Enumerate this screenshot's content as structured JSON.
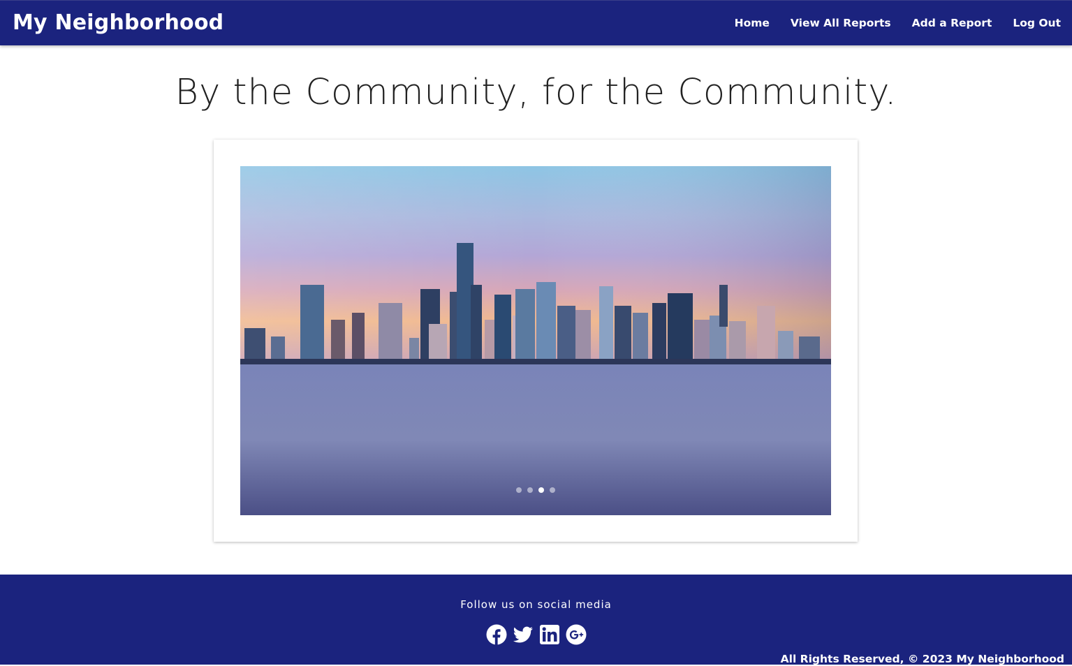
{
  "header": {
    "brand": "My Neighborhood",
    "nav": [
      {
        "label": "Home"
      },
      {
        "label": "View All Reports"
      },
      {
        "label": "Add a Report"
      },
      {
        "label": "Log Out"
      }
    ],
    "background": "#1b237e"
  },
  "hero": {
    "title": "By the Community, for the Community."
  },
  "carousel": {
    "image": "city-skyline-waterfront-at-dusk",
    "slide_count": 4,
    "active_index": 2
  },
  "footer": {
    "follow_text": "Follow us on social media",
    "social": [
      "facebook-icon",
      "twitter-icon",
      "linkedin-icon",
      "google-plus-icon"
    ],
    "copyright": "All Rights Reserved, © 2023 My Neighborhood",
    "background": "#1b237e"
  }
}
